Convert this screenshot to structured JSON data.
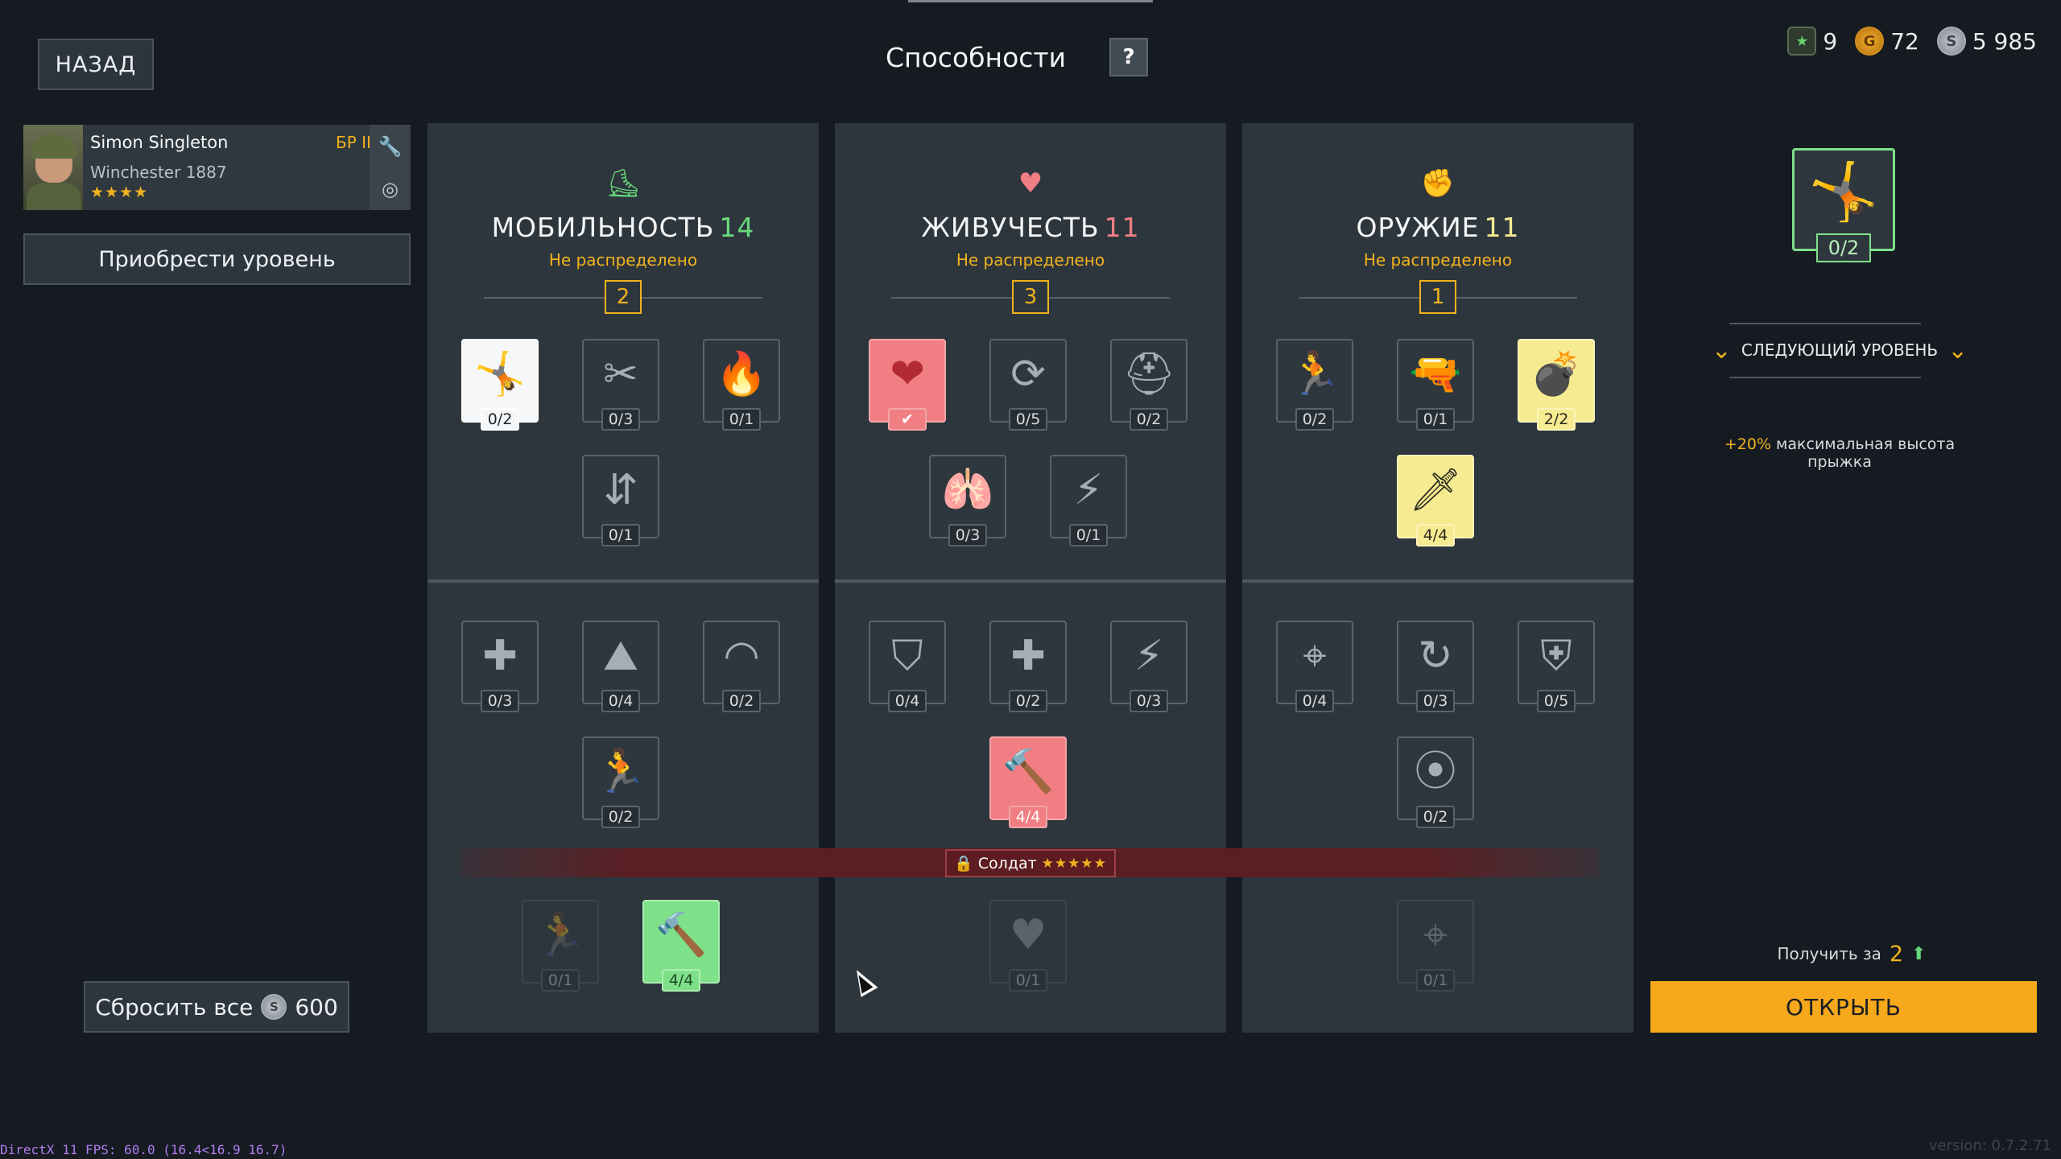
{
  "header": {
    "back_label": "НАЗАД",
    "title": "Способности",
    "help_label": "?",
    "currencies": [
      {
        "icon": "star-token-icon",
        "value": "9"
      },
      {
        "icon": "gold-coin-icon",
        "value": "72"
      },
      {
        "icon": "silver-coin-icon",
        "value": "5 985"
      }
    ]
  },
  "soldier": {
    "name": "Simon Singleton",
    "weapon": "Winchester 1887",
    "stars": "★★★★",
    "rank": "БР II"
  },
  "buy_level_label": "Приобрести уровень",
  "reset": {
    "label": "Сбросить все",
    "cost": "600"
  },
  "columns": [
    {
      "icon": "mobility-boot-icon",
      "title": "МОБИЛЬНОСТЬ",
      "level": "14",
      "unassigned_label": "Не распределено",
      "points": "2",
      "accent": "#67d97a",
      "tiles": [
        {
          "name": "jump-height",
          "glyph": "🤸",
          "count": "0/2",
          "state": "white"
        },
        {
          "name": "crawl-barbed-wire",
          "glyph": "✂",
          "count": "0/3",
          "state": "normal"
        },
        {
          "name": "fire-resistance",
          "glyph": "🔥",
          "count": "0/1",
          "state": "normal"
        },
        {
          "name": "crouch-stance",
          "glyph": "⇵",
          "count": "0/1",
          "state": "normal"
        },
        {
          "name": "sprint-heal",
          "glyph": "✚",
          "count": "0/3",
          "state": "normal"
        },
        {
          "name": "climb",
          "glyph": "⛰",
          "count": "0/4",
          "state": "normal"
        },
        {
          "name": "parachute",
          "glyph": "◠",
          "count": "0/2",
          "state": "normal"
        },
        {
          "name": "run-speed",
          "glyph": "🏃",
          "count": "0/2",
          "state": "normal"
        },
        {
          "name": "sprint-speed",
          "glyph": "🏃",
          "count": "0/1",
          "state": "dim"
        },
        {
          "name": "build-speed",
          "glyph": "🔨",
          "count": "4/4",
          "state": "green"
        }
      ]
    },
    {
      "icon": "vitality-heart-icon",
      "title": "ЖИВУЧЕСТЬ",
      "level": "11",
      "unassigned_label": "Не распределено",
      "points": "3",
      "accent": "#f07e83",
      "tiles": [
        {
          "name": "health",
          "glyph": "❤",
          "count": "✔",
          "state": "red"
        },
        {
          "name": "heart-regen",
          "glyph": "⟳",
          "count": "0/5",
          "state": "normal"
        },
        {
          "name": "helmet",
          "glyph": "⛑",
          "count": "0/2",
          "state": "normal"
        },
        {
          "name": "lungs",
          "glyph": "🫁",
          "count": "0/3",
          "state": "normal"
        },
        {
          "name": "stamina-regen",
          "glyph": "⚡",
          "count": "0/1",
          "state": "normal"
        },
        {
          "name": "armor-shield",
          "glyph": "⛉",
          "count": "0/4",
          "state": "normal"
        },
        {
          "name": "heal-boost",
          "glyph": "✚",
          "count": "0/2",
          "state": "normal"
        },
        {
          "name": "stamina-boost",
          "glyph": "⚡",
          "count": "0/3",
          "state": "normal"
        },
        {
          "name": "repair-kit",
          "glyph": "🔨",
          "count": "4/4",
          "state": "red"
        },
        {
          "name": "max-health",
          "glyph": "♥",
          "count": "0/1",
          "state": "dim"
        }
      ]
    },
    {
      "icon": "weapon-fist-icon",
      "title": "ОРУЖИЕ",
      "level": "11",
      "unassigned_label": "Не распределено",
      "points": "1",
      "accent": "#f7eb92",
      "tiles": [
        {
          "name": "weapon-swap",
          "glyph": "🏃",
          "count": "0/2",
          "state": "normal"
        },
        {
          "name": "pistol",
          "glyph": "🔫",
          "count": "0/1",
          "state": "normal"
        },
        {
          "name": "grenade-throw",
          "glyph": "💣",
          "count": "2/2",
          "state": "yellow"
        },
        {
          "name": "knife",
          "glyph": "🗡",
          "count": "4/4",
          "state": "yellow"
        },
        {
          "name": "aim-focus",
          "glyph": "⌖",
          "count": "0/4",
          "state": "normal"
        },
        {
          "name": "reload",
          "glyph": "↻",
          "count": "0/3",
          "state": "normal"
        },
        {
          "name": "medic-shield",
          "glyph": "⛨",
          "count": "0/5",
          "state": "normal"
        },
        {
          "name": "ammo-capacity",
          "glyph": "⦿",
          "count": "0/2",
          "state": "normal"
        },
        {
          "name": "steady-aim",
          "glyph": "⌖",
          "count": "0/1",
          "state": "dim"
        }
      ]
    }
  ],
  "lock": {
    "label": "Солдат",
    "stars": "★★★★★"
  },
  "details": {
    "selected_count": "0/2",
    "next_level_label": "СЛЕДУЮЩИЙ УРОВЕНЬ",
    "effect_accent": "+20%",
    "effect_text": " максимальная высота прыжка",
    "cost_label": "Получить за",
    "cost_value": "2",
    "open_label": "ОТКРЫТЬ"
  },
  "footer": {
    "debug": "DirectX 11 FPS: 60.0 (16.4<16.9 16.7)",
    "version": "version: 0.7.2.71"
  }
}
